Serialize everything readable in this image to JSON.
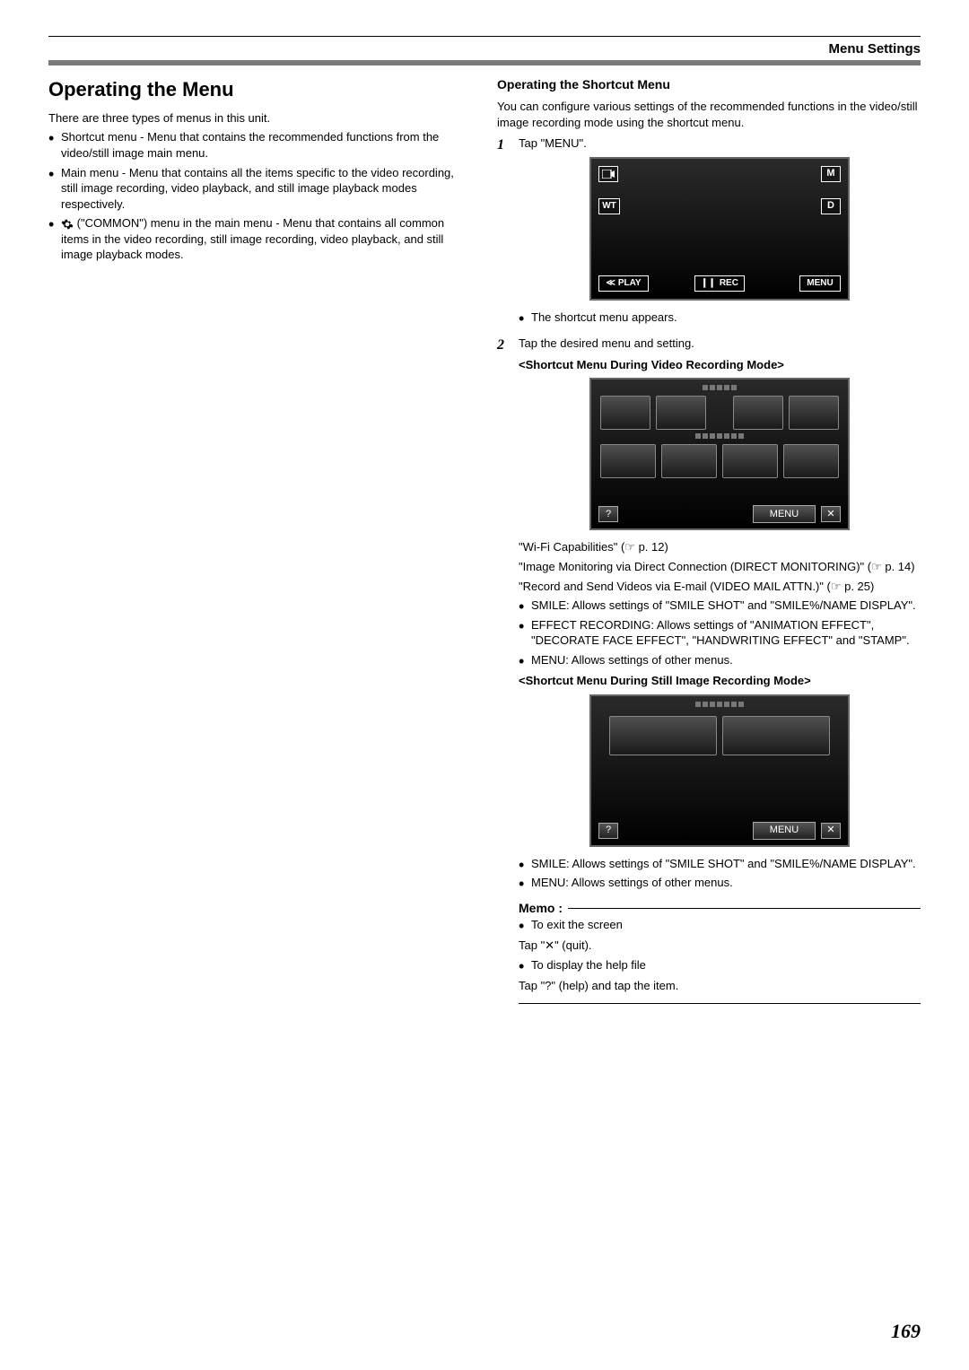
{
  "header": {
    "label": "Menu Settings"
  },
  "left": {
    "title": "Operating the Menu",
    "intro": "There are three types of menus in this unit.",
    "bullets": [
      "Shortcut menu - Menu that contains the recommended functions from the video/still image main menu.",
      "Main menu - Menu that contains all the items specific to the video recording, still image recording, video playback, and still image playback modes respectively.",
      " (\"COMMON\") menu in the main menu - Menu that contains all common items in the video recording, still image recording, video playback, and still image playback modes."
    ],
    "gear_prefix": "⚙"
  },
  "right": {
    "subtitle": "Operating the Shortcut Menu",
    "intro": "You can configure various settings of the recommended functions in the video/still image recording mode using the shortcut menu.",
    "step1_num": "1",
    "step1_text": "Tap \"MENU\".",
    "screen1": {
      "wt": "WT",
      "m": "M",
      "d": "D",
      "play": "PLAY",
      "rec": "REC",
      "menu": "MENU"
    },
    "after_screen1": "The shortcut menu appears.",
    "step2_num": "2",
    "step2_text": "Tap the desired menu and setting.",
    "video_mode_label": "<Shortcut Menu During Video Recording Mode>",
    "grid_menu_label": "MENU",
    "help_symbol": "?",
    "close_symbol": "✕",
    "video_refs": [
      "\"Wi-Fi Capabilities\" (☞ p. 12)",
      "\"Image Monitoring via Direct Connection (DIRECT MONITORING)\" (☞ p. 14)",
      "\"Record and Send Videos via E-mail (VIDEO MAIL ATTN.)\" (☞ p. 25)"
    ],
    "video_bullets": [
      "SMILE: Allows settings of \"SMILE SHOT\" and \"SMILE%/NAME DISPLAY\".",
      "EFFECT RECORDING: Allows settings of \"ANIMATION EFFECT\", \"DECORATE FACE EFFECT\", \"HANDWRITING EFFECT\" and \"STAMP\".",
      "MENU: Allows settings of other menus."
    ],
    "still_mode_label": "<Shortcut Menu During Still Image Recording Mode>",
    "still_bullets": [
      "SMILE: Allows settings of \"SMILE SHOT\" and \"SMILE%/NAME DISPLAY\".",
      "MENU: Allows settings of other menus."
    ],
    "memo_label": "Memo :",
    "memo_items": {
      "b1": "To exit the screen",
      "l1": "Tap \"✕\" (quit).",
      "b2": "To display the help file",
      "l2": "Tap \"?\" (help) and tap the item."
    }
  },
  "page_number": "169"
}
